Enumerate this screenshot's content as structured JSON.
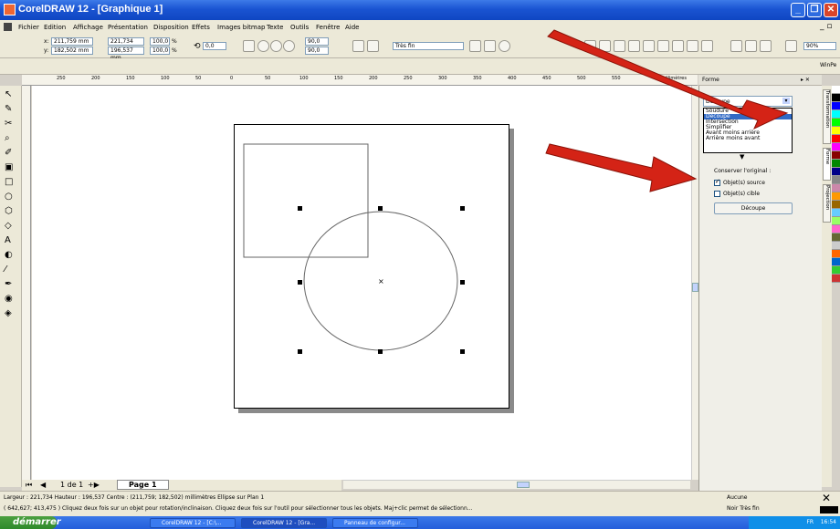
{
  "window": {
    "title": "CorelDRAW 12 - [Graphique 1]"
  },
  "menu": [
    "Fichier",
    "Edition",
    "Affichage",
    "Présentation",
    "Disposition",
    "Effets",
    "Images bitmap",
    "Texte",
    "Outils",
    "Fenêtre",
    "Aide"
  ],
  "propbar": {
    "x": "211,759 mm",
    "y": "182,502 mm",
    "w": "221,734 mm",
    "h": "196,537 mm",
    "scale_w": "100,0",
    "scale_h": "100,0",
    "pct": "%",
    "angle": "0,0",
    "angle2": "90,0",
    "angle3": "90,0",
    "outline": "Très fin",
    "zoom": "90%"
  },
  "workspace_label": "WinPe",
  "ruler": {
    "unit": "millimètres",
    "ticks": [
      "250",
      "200",
      "150",
      "100",
      "50",
      "0",
      "50",
      "100",
      "150",
      "200",
      "250",
      "300",
      "350",
      "400",
      "450",
      "500",
      "550"
    ]
  },
  "docker": {
    "title": "Forme",
    "dropdown_value": "Découpe",
    "options": [
      "Soudure",
      "Découpe",
      "Intersection",
      "Simplifier",
      "Avant moins arrière",
      "Arrière moins avant"
    ],
    "selected_option": "Découpe",
    "keep_label": "Conserver l'original :",
    "source_label": "Objet(s) source",
    "target_label": "Objet(s) cible",
    "source_checked": true,
    "target_checked": false,
    "apply_label": "Découpe",
    "side_tabs": [
      "Transformation",
      "Forme",
      "Projection"
    ]
  },
  "page_nav": {
    "counter": "1 de 1",
    "tab": "Page 1"
  },
  "status": {
    "line1": "Largeur : 221,734 Hauteur : 196,537 Centre : (211,759; 182,502) millimètres      Ellipse sur Plan 1",
    "line2": "( 642,627; 413,475 )    Cliquez deux fois sur un objet pour rotation/inclinaison. Cliquez deux fois sur l'outil pour sélectionner tous les objets. Maj+clic permet de sélectionn...",
    "fill": "Aucune",
    "outline": "Noir  Très fin"
  },
  "taskbar": {
    "start": "démarrer",
    "tasks": [
      "CorelDRAW 12 - [C:\\...",
      "CorelDRAW 12 - [Gra...",
      "Panneau de configur..."
    ],
    "tray_lang": "FR",
    "clock": "16:54"
  },
  "colors": {
    "accent": "#316ac5",
    "title": "#0f46c2",
    "arrow": "#d42316"
  }
}
